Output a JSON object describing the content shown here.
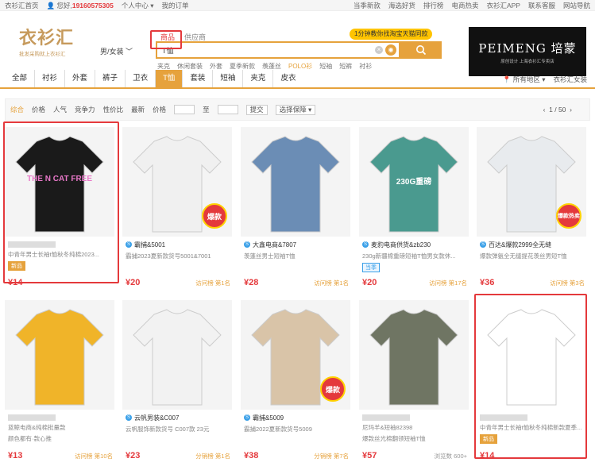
{
  "topbar": {
    "home": "衣衫汇首页",
    "greeting": "您好,",
    "phone": "19160575305",
    "personal": "个人中心",
    "orders": "我的订单",
    "right_items": [
      "当季新款",
      "海选好货",
      "排行榜",
      "电商热卖",
      "衣衫汇APP",
      "联系客服",
      "网站导航"
    ]
  },
  "logo": {
    "main": "衣衫汇",
    "sub": "批发采购就上衣衫汇"
  },
  "gender_select": "男/女装",
  "search": {
    "tabs": [
      "商品",
      "供应商"
    ],
    "query": "T恤",
    "promo": "1分钟教你找淘宝天猫同款",
    "hot_words": [
      "夹克",
      "休闲套装",
      "外套",
      "夏季新款",
      "羡蓬丝",
      "POLO衫",
      "短袖",
      "短裤",
      "衬衫"
    ]
  },
  "banner": {
    "title": "PEIMENG 培蒙",
    "sub": "原创设计 上海衣衫汇专卖店"
  },
  "categories": [
    "全部",
    "衬衫",
    "外套",
    "裤子",
    "卫衣",
    "T恤",
    "套装",
    "短袖",
    "夹克",
    "皮衣"
  ],
  "active_category": "T恤",
  "region": {
    "area": "所有地区",
    "brand": "衣衫汇女装"
  },
  "filters": {
    "sorts": [
      "综合",
      "价格",
      "人气",
      "竞争力",
      "性价比",
      "最新"
    ],
    "price_label": "价格",
    "to": "至",
    "submit": "提交",
    "guarantee": "选择保障",
    "pager": "1 / 50"
  },
  "products": [
    {
      "shop": "",
      "desc": "中青年男士长袖t恤秋冬纯棉2023...",
      "tag": "新品",
      "price": "¥14",
      "rank": "",
      "img_color": "#1a1a1a",
      "text_on_img": "THE N CAT FREE"
    },
    {
      "shop": "霸捕&5001",
      "desc": "霸捕2023夏新款货号5001&7001",
      "tag": "",
      "price": "¥20",
      "rank": "访问榜 第1名",
      "img_color": "#f0f0f0",
      "hot": "爆款"
    },
    {
      "shop": "大鑫电商&7807",
      "desc": "羡蓬丝男士短袖T恤",
      "tag": "",
      "price": "¥28",
      "rank": "访问榜 第1名",
      "img_color": "#6b8db5"
    },
    {
      "shop": "麦豹电商供货&zb230",
      "desc": "230g新疆棉重磅短袖T恤男女款休...",
      "tag": "当季",
      "price": "¥20",
      "rank": "访问榜 第17名",
      "img_color": "#4a9a8f",
      "text_on_img": "230G重磅"
    },
    {
      "shop": "百达&爆款2999全无缝",
      "desc": "爆款弹氨全无缝提花羡丝男短T恤",
      "tag": "",
      "price": "¥36",
      "rank": "访问榜 第3名",
      "img_color": "#e8ebee",
      "hot": "爆款热卖"
    },
    {
      "shop": "",
      "desc": "蓝鲸电商&纯棉批量款",
      "tag": "",
      "price": "¥13",
      "rank": "访问榜 第10名",
      "img_color": "#f0b429",
      "sub_desc": "颜色都有·款心推"
    },
    {
      "shop": "云帆男装&C007",
      "desc": "云帆服饰新款货号 C007款 23元",
      "tag": "",
      "price": "¥23",
      "rank": "分销榜 第1名",
      "img_color": "#f2f2f2"
    },
    {
      "shop": "霸捕&5009",
      "desc": "霸捕2022夏新款货号5009",
      "tag": "",
      "price": "¥38",
      "rank": "分销榜 第7名",
      "img_color": "#d9c4a8",
      "hot": "爆款"
    },
    {
      "shop": "",
      "desc": "尼玛羊&短袖82398",
      "tag": "",
      "price": "¥57",
      "rank": "浏览数 600+",
      "img_color": "#6f7563",
      "sub_desc": "爆款丝光棉翻领短袖T恤"
    },
    {
      "shop": "",
      "desc": "中青年男士长袖t恤秋冬纯棉新款夏季...",
      "tag": "新品",
      "price": "¥14",
      "rank": "",
      "img_color": "#ffffff"
    }
  ]
}
